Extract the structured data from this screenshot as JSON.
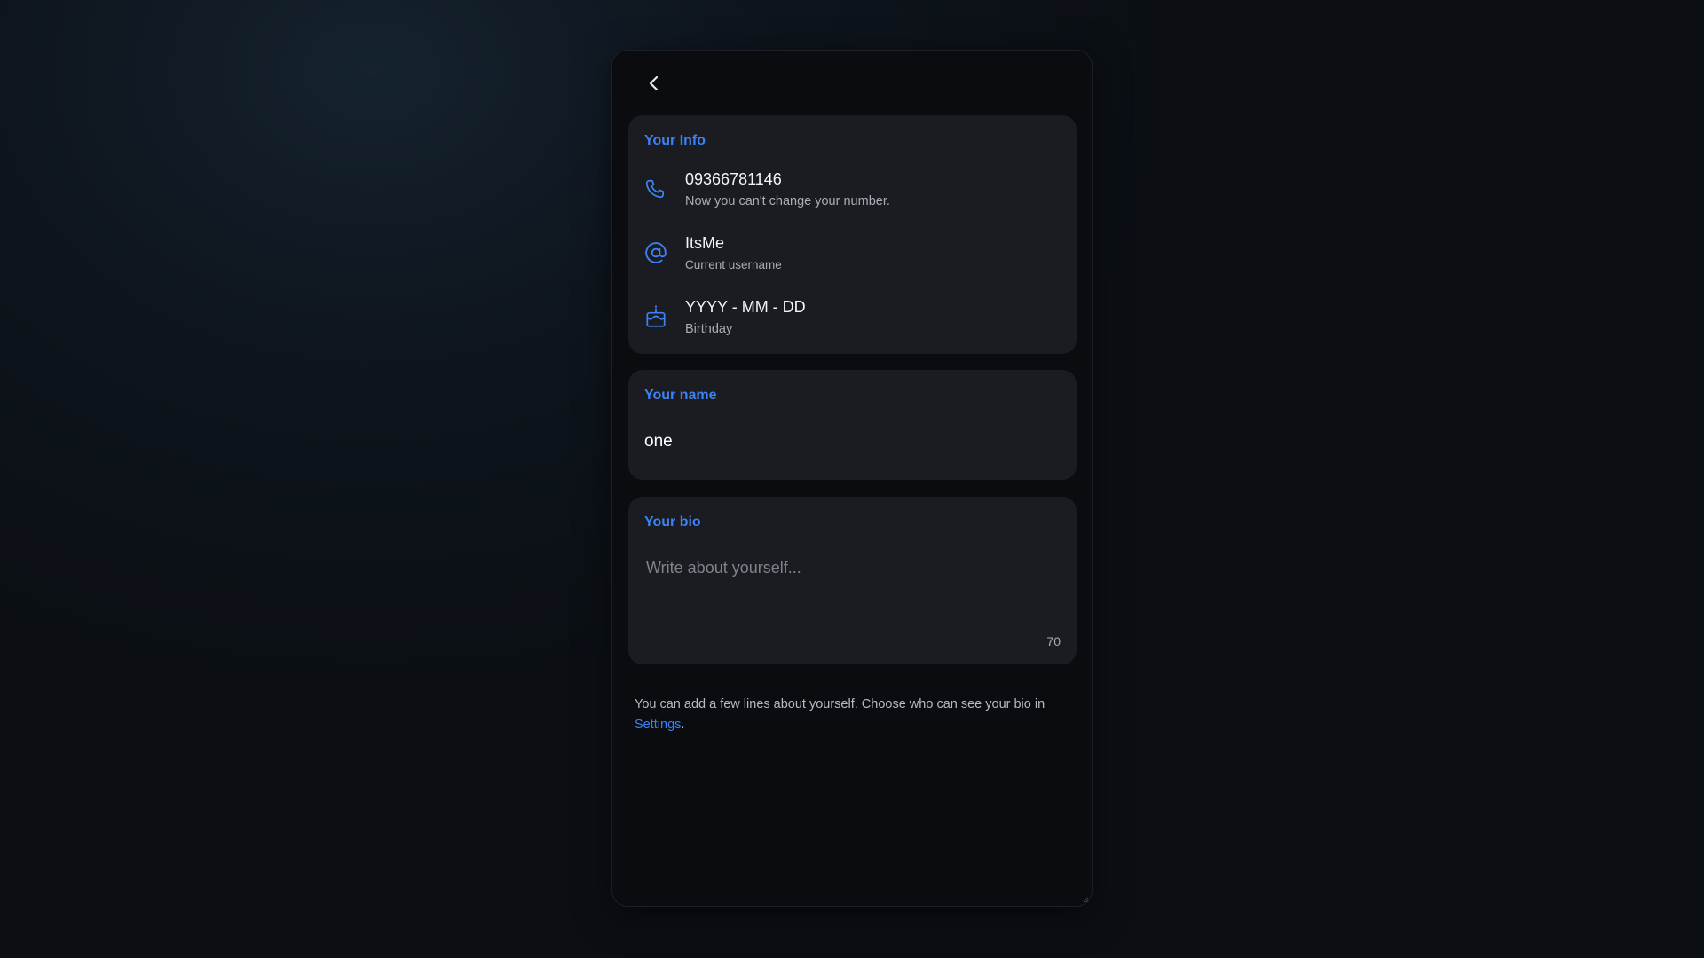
{
  "info_card": {
    "title": "Your Info",
    "phone": {
      "value": "09366781146",
      "note": "Now you can't change your number.",
      "icon": "phone-icon"
    },
    "username": {
      "value": "ItsMe",
      "note": "Current username",
      "icon": "at-sign-icon"
    },
    "birthday": {
      "value": "YYYY - MM - DD",
      "note": "Birthday",
      "icon": "cake-icon"
    }
  },
  "name_card": {
    "title": "Your name",
    "value": "one"
  },
  "bio_card": {
    "title": "Your bio",
    "placeholder": "Write about yourself...",
    "remaining": "70"
  },
  "helper": {
    "text": "You can add a few lines about yourself. Choose who can see your bio in ",
    "link": "Settings",
    "end": "."
  },
  "colors": {
    "accent": "#3b82f6",
    "card_bg": "#1b1c21",
    "panel_bg": "#0b0c0f"
  }
}
